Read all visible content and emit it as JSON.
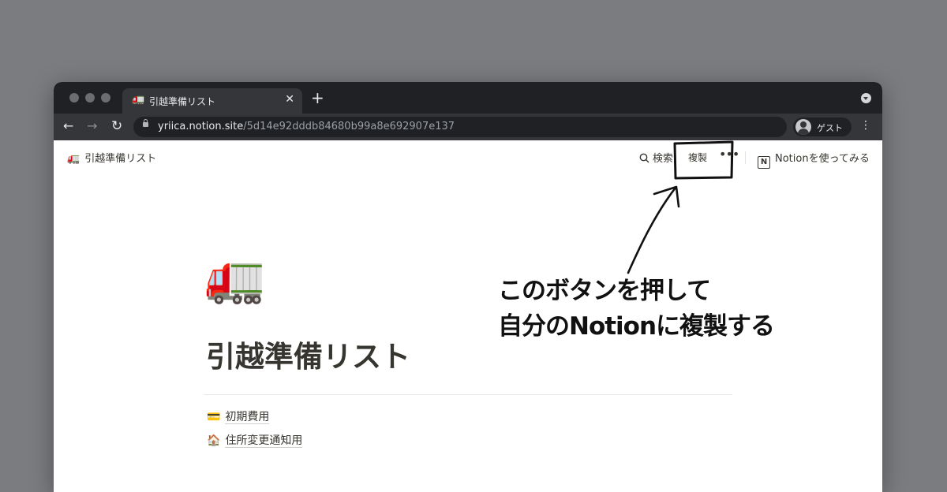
{
  "browser": {
    "tab_title": "引越準備リスト",
    "tab_favicon": "🚛",
    "tab_close": "✕",
    "new_tab": "+",
    "url_host": "yriica.notion.site",
    "url_path": "/5d14e92dddb84680b99a8e692907e137",
    "profile_label": "ゲスト",
    "nav_back": "←",
    "nav_forward": "→",
    "nav_reload": "↻",
    "menu": "⋮"
  },
  "notion_header": {
    "breadcrumb_icon": "🚛",
    "breadcrumb_title": "引越準備リスト",
    "search_label": "検索",
    "duplicate_label": "複製",
    "more_label": "•••",
    "try_notion_label": "Notionを使ってみる",
    "notion_logo": "N"
  },
  "page": {
    "icon": "🚛",
    "title": "引越準備リスト",
    "subpages": [
      {
        "icon": "💳",
        "label": "初期費用"
      },
      {
        "icon": "🏠",
        "label": "住所変更通知用"
      }
    ]
  },
  "annotation": {
    "line1": "このボタンを押して",
    "line2": "自分のNotionに複製する"
  },
  "colors": {
    "background": "#7b7c80",
    "tab_strip": "#202124",
    "toolbar": "#35363a",
    "page_text": "#37352f"
  }
}
